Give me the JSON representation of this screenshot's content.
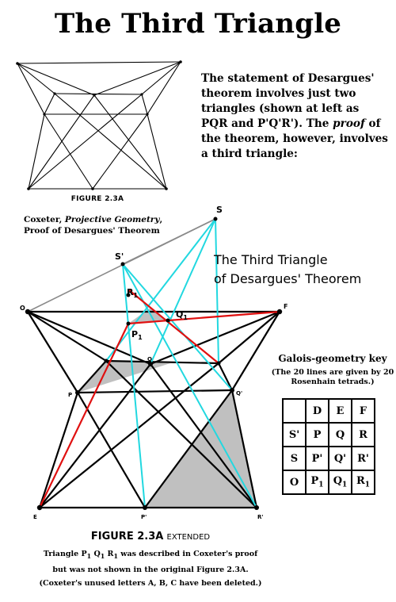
{
  "header": {
    "title": "The Third Triangle"
  },
  "intro": {
    "part1": "The statement of Desargues' theorem involves just two triangles (shown at left as PQR and P'Q'R').  The ",
    "part2": "proof",
    "part3": " of the theorem, however, involves a third triangle:"
  },
  "small_figure": {
    "caption": "FIGURE 2.3A"
  },
  "citation": {
    "author": "Coxeter, ",
    "book": "Projective Geometry",
    "after_book": ",",
    "subject": "Proof of Desargues' Theorem"
  },
  "big_figure": {
    "title_line1": "The Third Triangle",
    "title_line2": "of Desargues' Theorem",
    "labels": {
      "S": "S",
      "S_prime": "S'",
      "R1_base": "R",
      "R1_sub": "1",
      "Q1_base": "Q",
      "Q1_sub": "1",
      "P1_base": "P",
      "P1_sub": "1",
      "O": "O",
      "F": "F",
      "E": "E",
      "P_prime": "P'",
      "R_prime": "R'",
      "Q_prime": "Q'",
      "P": "P",
      "Q": "Q"
    }
  },
  "key": {
    "title": "Galois-geometry key",
    "subtitle": "(The 20 lines are given by 20 Rosenhain tetrads.)",
    "header": [
      "",
      "D",
      "E",
      "F"
    ],
    "rows": [
      [
        "S'",
        "P",
        "Q",
        "R"
      ],
      [
        "S",
        "P'",
        "Q'",
        "R'"
      ],
      [
        "O",
        "P1",
        "Q1",
        "R1"
      ]
    ],
    "row3": {
      "O": "O",
      "P1_base": "P",
      "P1_sub": "1",
      "Q1_base": "Q",
      "Q1_sub": "1",
      "R1_base": "R",
      "R1_sub": "1"
    }
  },
  "caption": {
    "figure_label": "FIGURE 2.3A",
    "extended": "EXTENDED",
    "line1_pre": "Triangle P",
    "line1_sub1": "1",
    "line1_mid1": " Q",
    "line1_sub2": "1",
    "line1_mid2": " R",
    "line1_sub3": "1",
    "line1_post": " was described in Coxeter's proof",
    "line2": "but was not shown in the original Figure 2.3A.",
    "line3": "(Coxeter's unused letters A, B, C have been deleted.)"
  },
  "colors": {
    "red": "#e01010",
    "cyan": "#22d8e0",
    "gray_fill": "#c0c0c0",
    "gray_line": "#8a8a8a"
  }
}
